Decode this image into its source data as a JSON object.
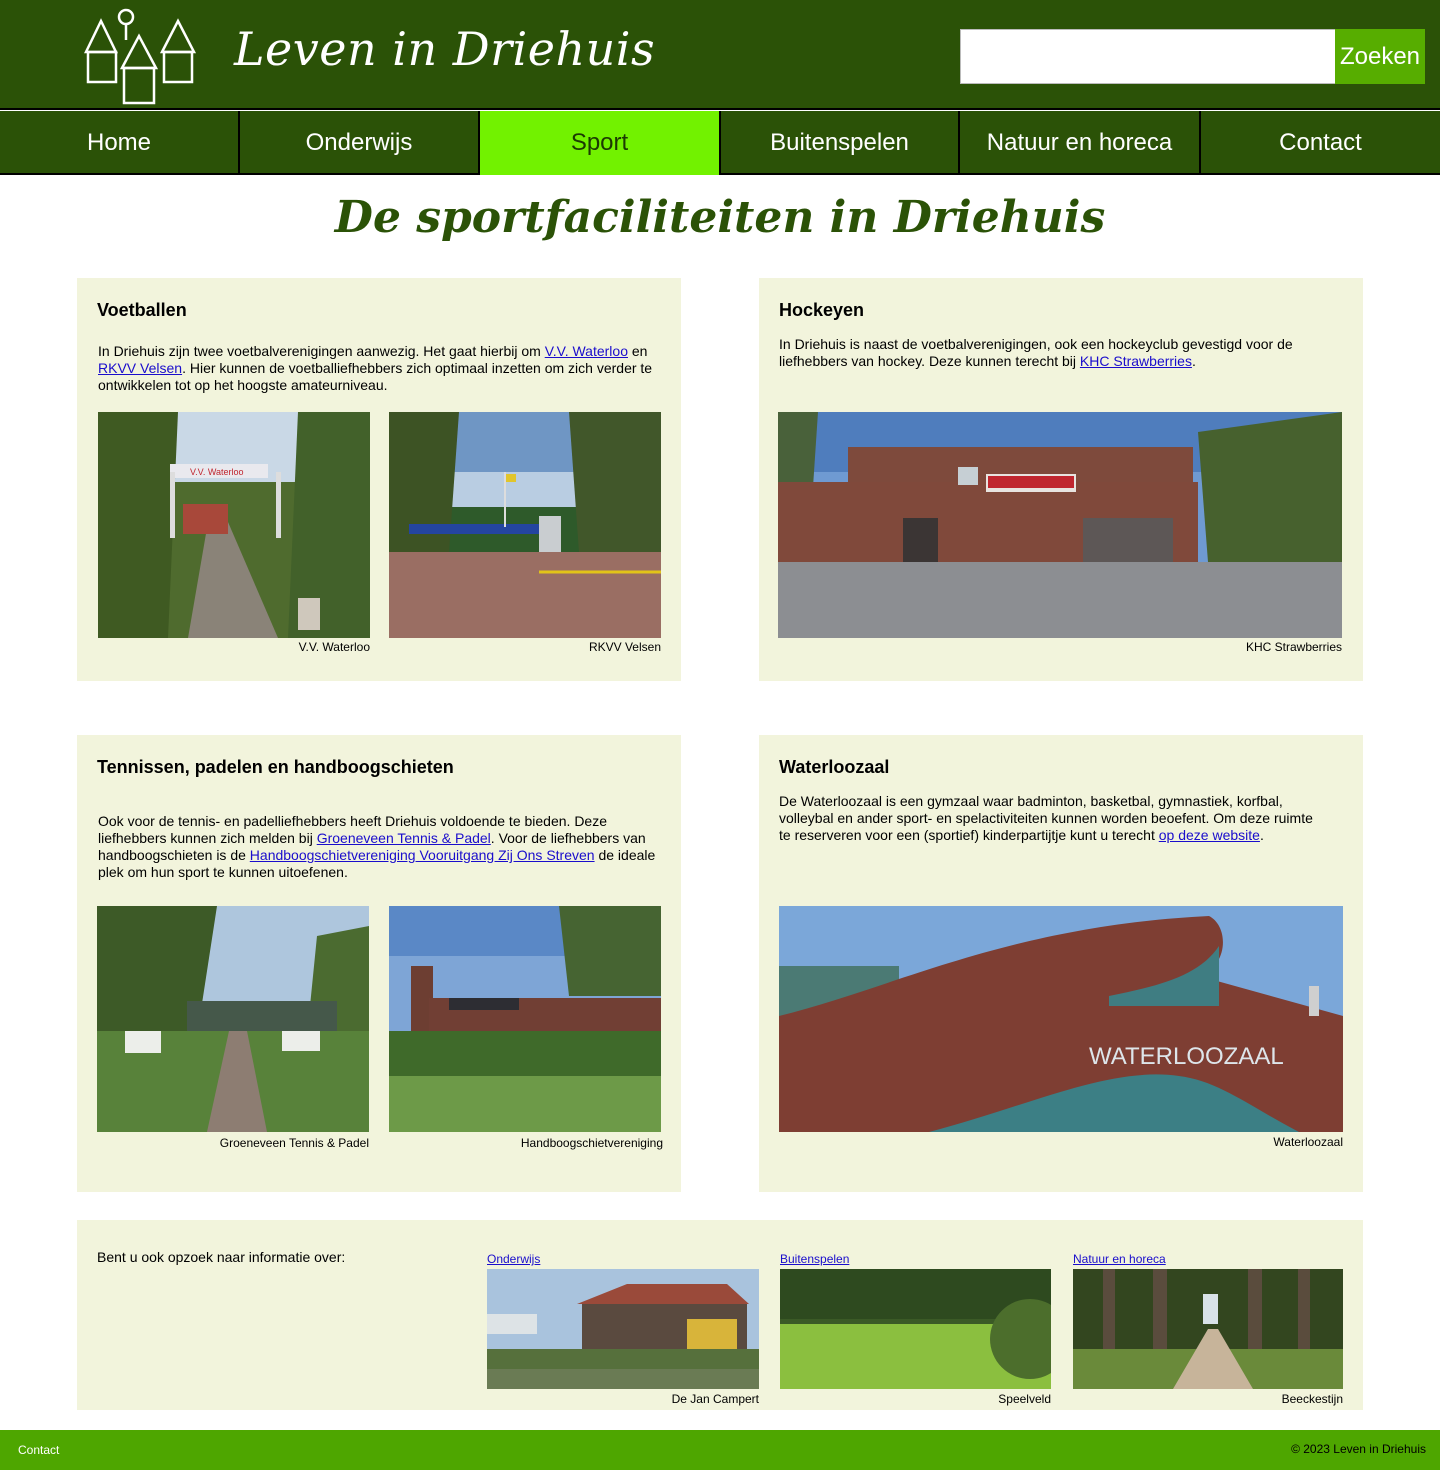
{
  "header": {
    "site_title": "Leven in Driehuis",
    "search_placeholder": "",
    "search_button": "Zoeken"
  },
  "nav": {
    "items": [
      "Home",
      "Onderwijs",
      "Sport",
      "Buitenspelen",
      "Natuur en horeca",
      "Contact"
    ],
    "active": "Sport"
  },
  "page_title": "De sportfaciliteiten in Driehuis",
  "voetballen": {
    "heading": "Voetballen",
    "text_1": "In Driehuis zijn twee voetbalverenigingen aanwezig. Het gaat hierbij om ",
    "link_1": "V.V. Waterloo",
    "text_2": " en ",
    "link_2": "RKVV Velsen",
    "text_3": ". Hier kunnen de voetballiefhebbers zich optimaal inzetten om zich verder te ontwikkelen tot op het hoogste amateurniveau.",
    "caption_1": "V.V. Waterloo",
    "caption_2": "RKVV Velsen"
  },
  "hockeyen": {
    "heading": "Hockeyen",
    "text_1": "In Driehuis is naast de voetbalverenigingen, ook een hockeyclub gevestigd voor de liefhebbers van hockey. Deze kunnen terecht bij ",
    "link_1": "KHC Strawberries",
    "text_2": ".",
    "caption": "KHC Strawberries"
  },
  "tennis": {
    "heading": "Tennissen, padelen en handboogschieten",
    "text_1": "Ook voor de tennis- en padelliefhebbers heeft Driehuis voldoende te bieden. Deze liefhebbers kunnen zich melden bij ",
    "link_1": "Groeneveen Tennis & Padel",
    "text_2": ". Voor de liefhebbers van handboogschieten is de ",
    "link_2": "Handboogschietvereniging Vooruitgang Zij Ons Streven",
    "text_3": " de ideale plek om hun sport te kunnen uitoefenen.",
    "caption_1": "Groeneveen Tennis & Padel",
    "caption_2": "Handboogschietvereniging"
  },
  "waterloozaal": {
    "heading": "Waterloozaal",
    "text_1": "De Waterloozaal is een gymzaal waar badminton, basketbal, gymnastiek, korfbal, volleybal en ander sport- en spelactiviteiten kunnen worden beoefent. Om deze ruimte te reserveren voor een (sportief) kinderpartijtje kunt u terecht ",
    "link_1": "op deze website",
    "text_2": ".",
    "caption": "Waterloozaal"
  },
  "related": {
    "intro": "Bent u ook opzoek naar informatie over:",
    "items": [
      {
        "link": "Onderwijs",
        "caption": "De Jan Campert"
      },
      {
        "link": "Buitenspelen",
        "caption": "Speelveld"
      },
      {
        "link": "Natuur en horeca",
        "caption": "Beeckestijn"
      }
    ]
  },
  "footer": {
    "contact": "Contact",
    "copyright": "© 2023 Leven in Driehuis"
  },
  "colors": {
    "header_bg": "#2b5207",
    "nav_active": "#72f200",
    "card_bg": "#f2f4dc",
    "footer_bg": "#4ea600",
    "link": "#1a0dcc"
  }
}
